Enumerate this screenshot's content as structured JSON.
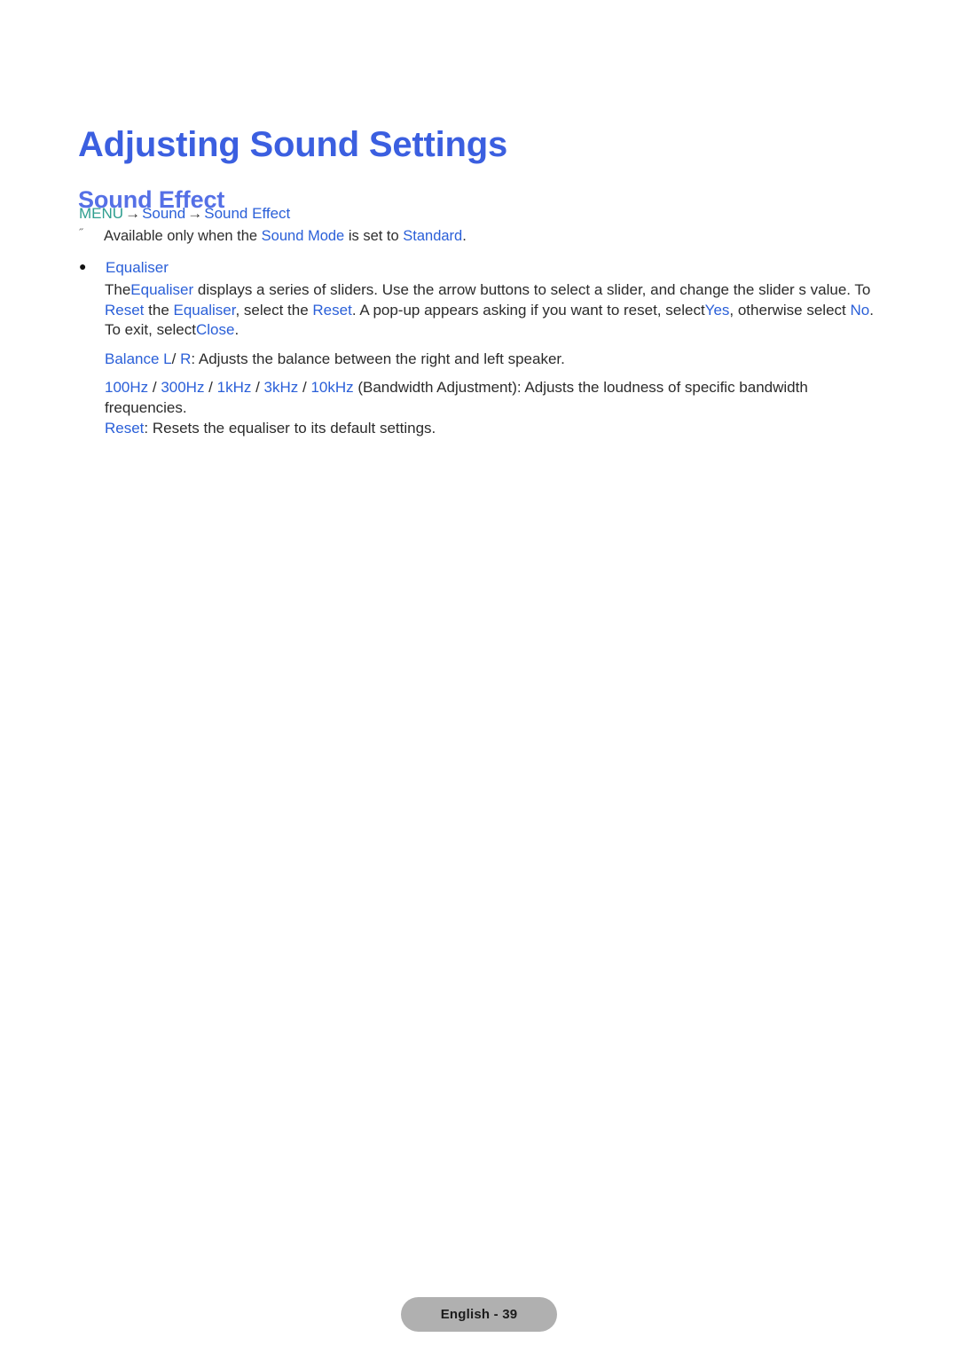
{
  "document": {
    "title": "Adjusting Sound Settings",
    "section_title": "Sound Effect"
  },
  "colors": {
    "heading_blue": "#3b5fe0",
    "subheading_blue": "#5570e6",
    "link_blue": "#2a5fd8",
    "menu_teal": "#2e9e8f",
    "body_text": "#2b2b2b",
    "badge_bg": "#b0b0b0"
  },
  "menu_path": {
    "menu_label": "MENU",
    "arrow": "→",
    "step1": "Sound",
    "step2": "Sound Effect"
  },
  "note": {
    "marker": "˝",
    "text_before": "Available only when the ",
    "link1": "Sound Mode",
    "text_middle": " is set to ",
    "link2": "Standard",
    "text_after": "."
  },
  "bullet": {
    "marker": "●",
    "label": "Equaliser"
  },
  "body": {
    "p1": {
      "t1": "The",
      "l1": "Equaliser",
      "t2": " displays a series of sliders. Use the arrow buttons to select a slider, and change the slider s value.",
      "t3": "To ",
      "l2": "Reset",
      "t4": " the ",
      "l3": "Equaliser",
      "t5": ", select the ",
      "l4": "Reset",
      "t6": ". A pop-up appears asking if you want to reset, select",
      "l5": "Yes",
      "t7": ", otherwise select ",
      "l6": "No",
      "t8": ". To exit, select",
      "l7": "Close",
      "t9": "."
    },
    "p2": {
      "l1": "Balance L",
      "sep": "/ ",
      "l2": "R",
      "t1": ": Adjusts the balance between the right and left speaker."
    },
    "p3": {
      "f1": "100Hz",
      "s1": " / ",
      "f2": "300Hz",
      "s2": " / ",
      "f3": "1kHz",
      "s3": " / ",
      "f4": "3kHz",
      "s4": " / ",
      "f5": "10kHz",
      "t1": " (Bandwidth Adjustment): Adjusts the loudness of specific bandwidth frequencies."
    },
    "p4": {
      "l1": "Reset",
      "t1": ": Resets the equaliser to its default settings."
    }
  },
  "footer": {
    "page_label": "English - 39"
  }
}
